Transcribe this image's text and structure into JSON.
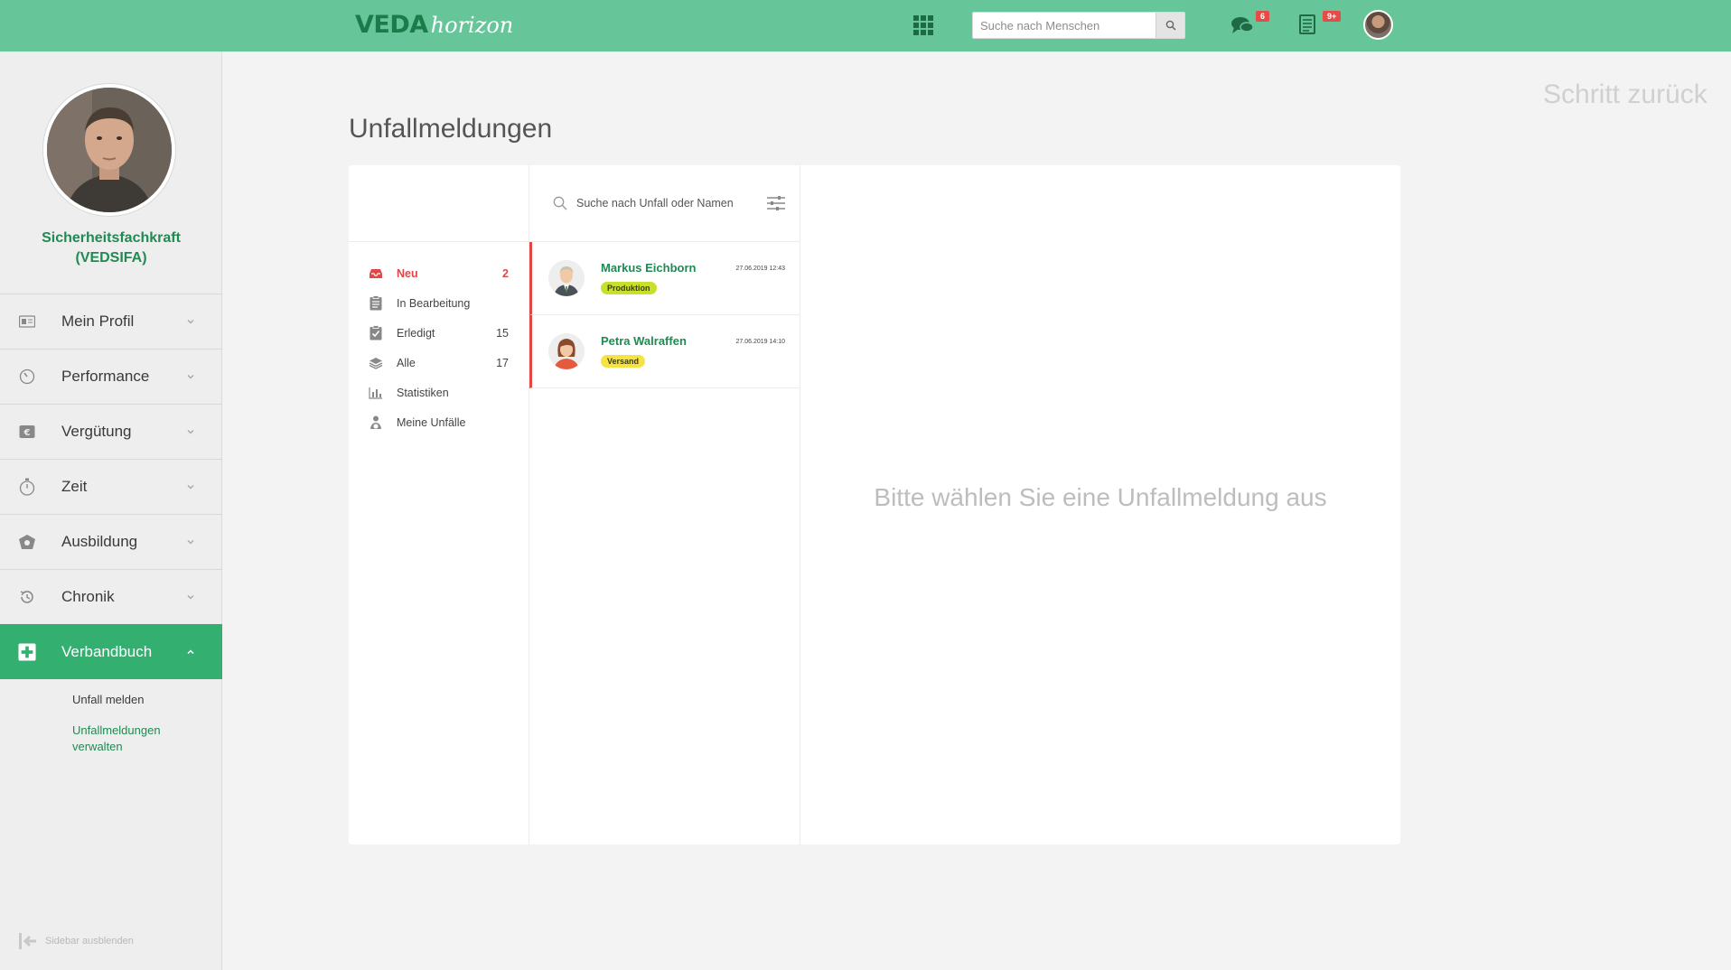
{
  "header": {
    "logo_bold": "VEDA",
    "logo_script": "horizon",
    "search_placeholder": "Suche nach Menschen",
    "messages_badge": "6",
    "tasks_badge": "9+"
  },
  "sidebar": {
    "profile_name_line1": "Sicherheitsfachkraft",
    "profile_name_line2": "(VEDSIFA)",
    "items": [
      {
        "label": "Mein Profil",
        "icon": "id-card-icon"
      },
      {
        "label": "Performance",
        "icon": "gauge-icon"
      },
      {
        "label": "Vergütung",
        "icon": "euro-icon"
      },
      {
        "label": "Zeit",
        "icon": "stopwatch-icon"
      },
      {
        "label": "Ausbildung",
        "icon": "graduation-icon"
      },
      {
        "label": "Chronik",
        "icon": "history-icon"
      },
      {
        "label": "Verbandbuch",
        "icon": "first-aid-icon"
      }
    ],
    "subitems": [
      {
        "label": "Unfall melden"
      },
      {
        "label": "Unfallmeldungen verwalten"
      }
    ],
    "hide_label": "Sidebar ausblenden",
    "accent_color": "#33b06f"
  },
  "main": {
    "back_link": "Schritt zurück",
    "title": "Unfallmeldungen",
    "filters": [
      {
        "label": "Neu",
        "count": "2",
        "icon": "inbox-icon"
      },
      {
        "label": "In Bearbeitung",
        "count": "",
        "icon": "clipboard-icon"
      },
      {
        "label": "Erledigt",
        "count": "15",
        "icon": "clipboard-check-icon"
      },
      {
        "label": "Alle",
        "count": "17",
        "icon": "layers-icon"
      },
      {
        "label": "Statistiken",
        "count": "",
        "icon": "bar-chart-icon"
      },
      {
        "label": "Meine Unfälle",
        "count": "",
        "icon": "user-injury-icon"
      }
    ],
    "list_search_placeholder": "Suche nach Unfall oder Namen",
    "entries": [
      {
        "name": "Markus Eichborn",
        "date": "27.06.2019 12:43",
        "tag": "Produktion",
        "tag_color": "#c9e02a"
      },
      {
        "name": "Petra Walraffen",
        "date": "27.06.2019 14:10",
        "tag": "Versand",
        "tag_color": "#f5e342"
      }
    ],
    "empty_message": "Bitte wählen Sie eine Unfallmeldung aus"
  }
}
